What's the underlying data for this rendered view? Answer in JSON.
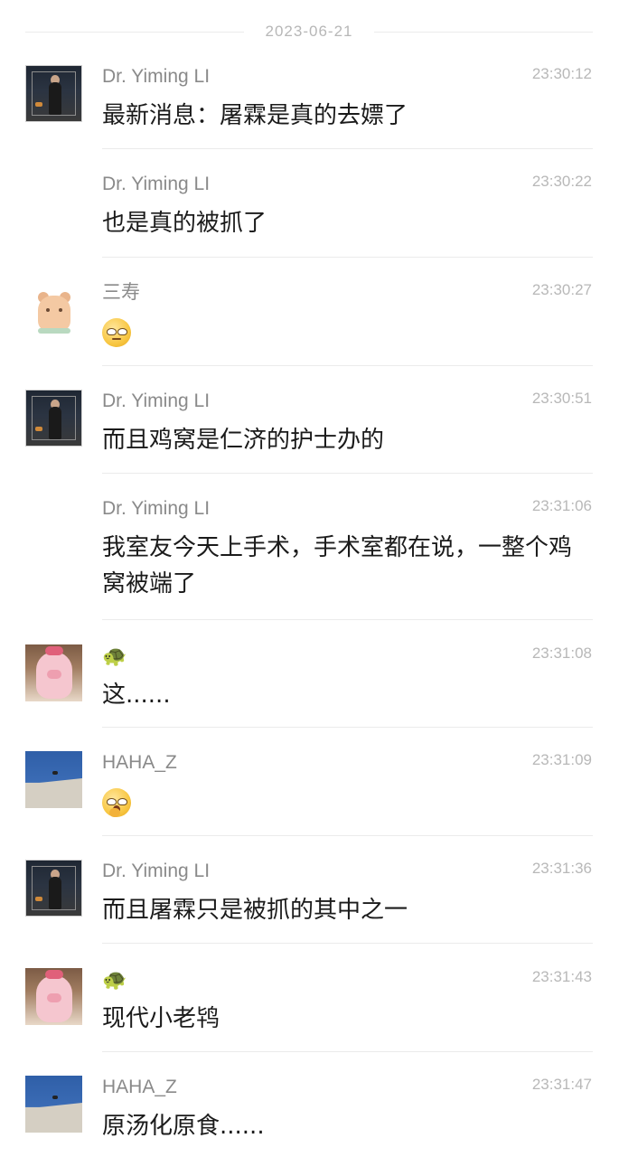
{
  "date_separator": "2023-06-21",
  "messages": [
    {
      "sender": "Dr. Yiming LI",
      "time": "23:30:12",
      "text": "最新消息：屠霖是真的去嫖了",
      "avatar_icon": "dark-photo-avatar"
    },
    {
      "sender": "Dr. Yiming LI",
      "time": "23:30:22",
      "text": "也是真的被抓了",
      "avatar_icon": ""
    },
    {
      "sender": "三寿",
      "time": "23:30:27",
      "text": "",
      "emoji_icon": "rolling-eyes-emoji",
      "avatar_icon": "bear-sticker-avatar"
    },
    {
      "sender": "Dr. Yiming LI",
      "time": "23:30:51",
      "text": "而且鸡窝是仁济的护士办的",
      "avatar_icon": "dark-photo-avatar"
    },
    {
      "sender": "Dr. Yiming LI",
      "time": "23:31:06",
      "text": "我室友今天上手术，手术室都在说，一整个鸡窝被端了",
      "avatar_icon": ""
    },
    {
      "sender": "🐢",
      "time": "23:31:08",
      "text": "这......",
      "avatar_icon": "pink-pig-avatar"
    },
    {
      "sender": "HAHA_Z",
      "time": "23:31:09",
      "text": "",
      "emoji_icon": "shocked-emoji",
      "avatar_icon": "blue-sky-avatar"
    },
    {
      "sender": "Dr. Yiming LI",
      "time": "23:31:36",
      "text": "而且屠霖只是被抓的其中之一",
      "avatar_icon": "dark-photo-avatar"
    },
    {
      "sender": "🐢",
      "time": "23:31:43",
      "text": "现代小老鸨",
      "avatar_icon": "pink-pig-avatar"
    },
    {
      "sender": "HAHA_Z",
      "time": "23:31:47",
      "text": "原汤化原食......",
      "avatar_icon": "blue-sky-avatar"
    }
  ]
}
